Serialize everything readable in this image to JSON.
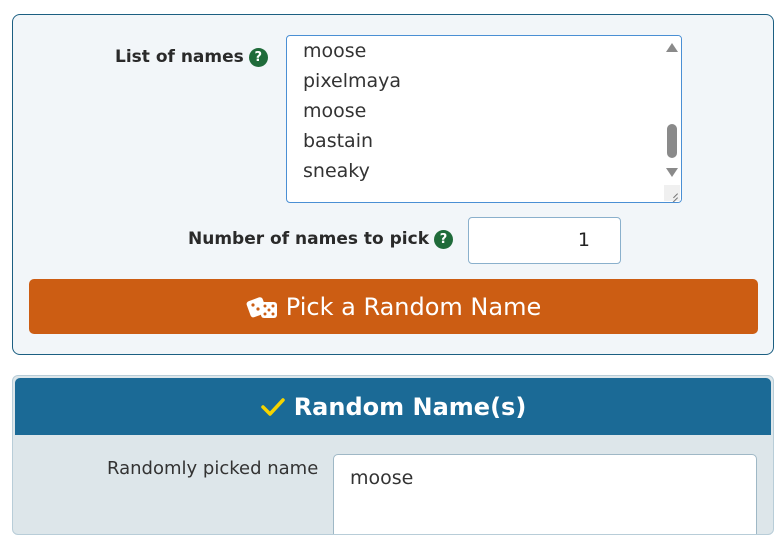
{
  "form": {
    "names_label": "List of names",
    "names": [
      "moose",
      "pixelmaya",
      "moose",
      "bastain",
      "sneaky"
    ],
    "count_label": "Number of names to pick",
    "count_value": "1",
    "pick_button": "Pick a Random Name",
    "help_glyph": "?"
  },
  "result": {
    "header": "Random Name(s)",
    "picked_label": "Randomly picked name",
    "picked_value": "moose"
  },
  "icons": {
    "help": "question-circle-icon",
    "dice": "dice-icon",
    "check": "checkmark-icon",
    "check_color": "#f5d400"
  },
  "colors": {
    "button": "#cc5d13",
    "header": "#1b6a96",
    "help": "#1f6b3a"
  }
}
